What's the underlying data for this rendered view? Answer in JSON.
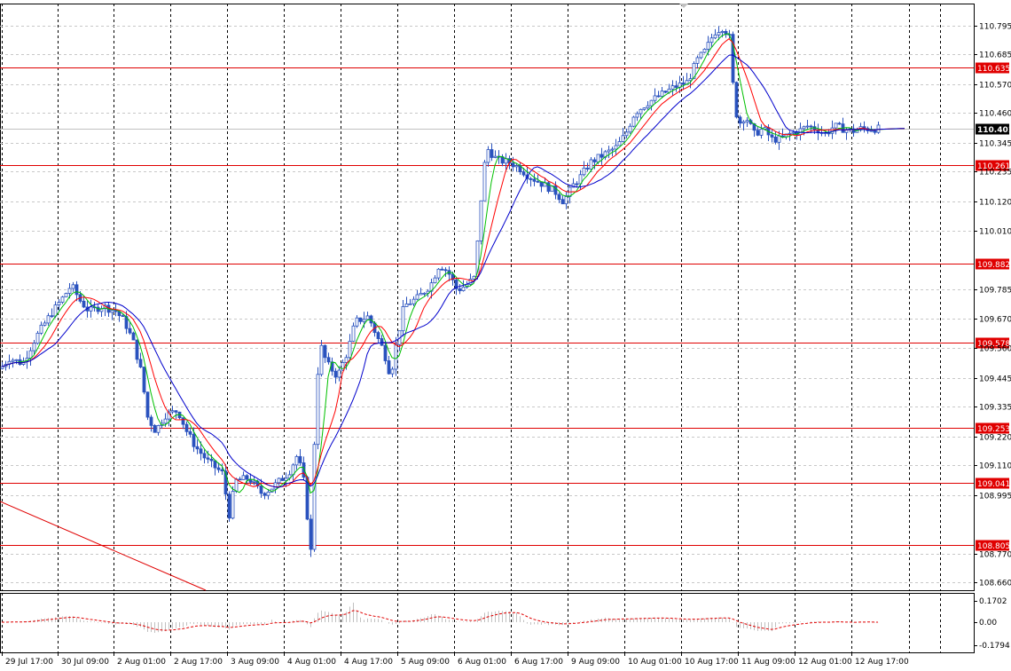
{
  "chart_data": {
    "type": "candlestick",
    "ylim": [
      108.63,
      110.88
    ],
    "y_ticks": [
      "110.795",
      "110.685",
      "110.570",
      "110.460",
      "110.345",
      "110.235",
      "110.120",
      "110.010",
      "109.785",
      "109.670",
      "109.560",
      "109.445",
      "109.335",
      "109.220",
      "109.110",
      "108.995",
      "108.770",
      "108.660"
    ],
    "current_price": "110.401",
    "horizontal_levels": [
      "110.635",
      "110.261",
      "109.882",
      "109.578",
      "109.253",
      "109.041",
      "108.805"
    ],
    "x_ticks": [
      "29 Jul 17:00",
      "30 Jul 09:00",
      "2 Aug 01:00",
      "2 Aug 17:00",
      "3 Aug 09:00",
      "4 Aug 01:00",
      "4 Aug 17:00",
      "5 Aug 09:00",
      "6 Aug 01:00",
      "6 Aug 17:00",
      "9 Aug 09:00",
      "10 Aug 01:00",
      "10 Aug 17:00",
      "11 Aug 09:00",
      "12 Aug 01:00",
      "12 Aug 17:00"
    ],
    "price_path": [
      [
        0,
        109.48
      ],
      [
        10,
        109.52
      ],
      [
        25,
        109.5
      ],
      [
        40,
        109.6
      ],
      [
        55,
        109.68
      ],
      [
        70,
        109.75
      ],
      [
        80,
        109.8
      ],
      [
        90,
        109.74
      ],
      [
        100,
        109.7
      ],
      [
        115,
        109.72
      ],
      [
        130,
        109.7
      ],
      [
        140,
        109.66
      ],
      [
        150,
        109.58
      ],
      [
        160,
        109.45
      ],
      [
        165,
        109.3
      ],
      [
        175,
        109.24
      ],
      [
        185,
        109.3
      ],
      [
        200,
        109.32
      ],
      [
        210,
        109.24
      ],
      [
        220,
        109.18
      ],
      [
        235,
        109.12
      ],
      [
        250,
        109.08
      ],
      [
        258,
        108.92
      ],
      [
        265,
        109.05
      ],
      [
        280,
        109.06
      ],
      [
        295,
        109.0
      ],
      [
        305,
        109.02
      ],
      [
        315,
        109.05
      ],
      [
        325,
        109.08
      ],
      [
        335,
        109.15
      ],
      [
        342,
        109.05
      ],
      [
        350,
        108.78
      ],
      [
        355,
        109.3
      ],
      [
        360,
        109.58
      ],
      [
        368,
        109.5
      ],
      [
        380,
        109.45
      ],
      [
        392,
        109.55
      ],
      [
        400,
        109.66
      ],
      [
        415,
        109.68
      ],
      [
        425,
        109.6
      ],
      [
        432,
        109.55
      ],
      [
        440,
        109.45
      ],
      [
        445,
        109.55
      ],
      [
        455,
        109.72
      ],
      [
        470,
        109.75
      ],
      [
        485,
        109.8
      ],
      [
        495,
        109.88
      ],
      [
        505,
        109.85
      ],
      [
        515,
        109.78
      ],
      [
        525,
        109.8
      ],
      [
        535,
        109.83
      ],
      [
        540,
        110.05
      ],
      [
        545,
        110.25
      ],
      [
        550,
        110.32
      ],
      [
        560,
        110.28
      ],
      [
        575,
        110.27
      ],
      [
        585,
        110.25
      ],
      [
        595,
        110.22
      ],
      [
        605,
        110.2
      ],
      [
        615,
        110.18
      ],
      [
        625,
        110.16
      ],
      [
        635,
        110.12
      ],
      [
        645,
        110.18
      ],
      [
        655,
        110.22
      ],
      [
        665,
        110.27
      ],
      [
        680,
        110.3
      ],
      [
        695,
        110.33
      ],
      [
        705,
        110.38
      ],
      [
        715,
        110.46
      ],
      [
        730,
        110.5
      ],
      [
        745,
        110.53
      ],
      [
        760,
        110.56
      ],
      [
        775,
        110.58
      ],
      [
        785,
        110.66
      ],
      [
        795,
        110.7
      ],
      [
        805,
        110.77
      ],
      [
        815,
        110.79
      ],
      [
        822,
        110.75
      ],
      [
        828,
        110.48
      ],
      [
        833,
        110.42
      ],
      [
        840,
        110.45
      ],
      [
        850,
        110.38
      ],
      [
        860,
        110.4
      ],
      [
        870,
        110.36
      ],
      [
        880,
        110.36
      ],
      [
        890,
        110.38
      ],
      [
        900,
        110.39
      ],
      [
        910,
        110.41
      ],
      [
        920,
        110.4
      ],
      [
        930,
        110.38
      ],
      [
        940,
        110.41
      ],
      [
        950,
        110.4
      ],
      [
        960,
        110.39
      ],
      [
        970,
        110.4
      ],
      [
        980,
        110.4
      ],
      [
        988,
        110.4
      ]
    ],
    "moving_averages": [
      {
        "color": "#00c000",
        "period": 5
      },
      {
        "color": "#ff0000",
        "period": 9
      },
      {
        "color": "#0000cc",
        "period": 16
      }
    ],
    "oscillator": {
      "y_ticks": [
        "0.1702",
        "0.00",
        "-0.1794"
      ]
    }
  },
  "colors": {
    "background": "#ffffff",
    "grid": "#000000",
    "level_line": "#e00000",
    "level_label_bg": "#e00000",
    "current_label_bg": "#000000",
    "candle": "#2a52be",
    "oscillator_bar": "#c0c0c0",
    "oscillator_signal": "#e00000"
  }
}
